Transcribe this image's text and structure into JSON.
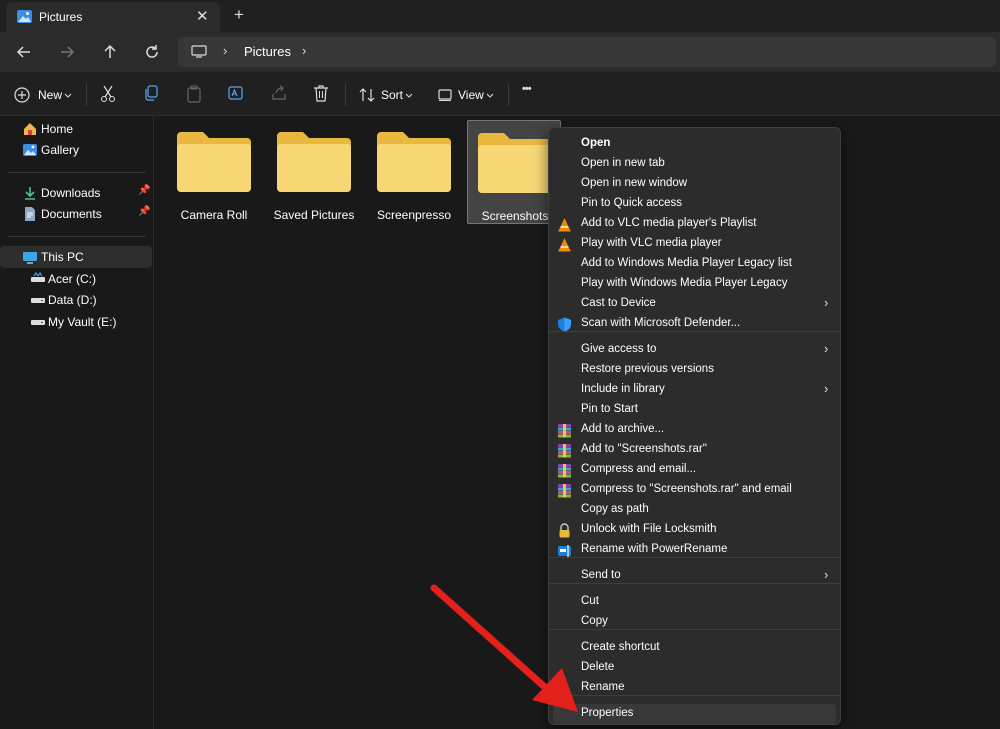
{
  "tab": {
    "title": "Pictures",
    "close": "✕",
    "new": "+"
  },
  "address": {
    "sep": "›",
    "crumb": "Pictures"
  },
  "commands": {
    "new": "New",
    "sort": "Sort",
    "view": "View",
    "more": "•••"
  },
  "sidebar": {
    "items": [
      {
        "label": "Home",
        "icon": "home-icon"
      },
      {
        "label": "Gallery",
        "icon": "gallery-icon"
      },
      {
        "label": "Downloads",
        "icon": "downloads-icon",
        "pinned": true
      },
      {
        "label": "Documents",
        "icon": "documents-icon",
        "pinned": true
      },
      {
        "label": "This PC",
        "icon": "this-pc-icon",
        "selected": true
      },
      {
        "label": "Acer (C:)",
        "icon": "drive-icon"
      },
      {
        "label": "Data (D:)",
        "icon": "drive-icon"
      },
      {
        "label": "My Vault (E:)",
        "icon": "drive-icon"
      }
    ]
  },
  "folders": [
    {
      "name": "Camera Roll"
    },
    {
      "name": "Saved Pictures"
    },
    {
      "name": "Screenpresso"
    },
    {
      "name": "Screenshots",
      "selected": true
    }
  ],
  "context_menu": {
    "items": [
      {
        "label": "Open",
        "bold": true
      },
      {
        "label": "Open in new tab"
      },
      {
        "label": "Open in new window"
      },
      {
        "label": "Pin to Quick access"
      },
      {
        "label": "Add to VLC media player's Playlist",
        "icon": "vlc-icon"
      },
      {
        "label": "Play with VLC media player",
        "icon": "vlc-icon"
      },
      {
        "label": "Add to Windows Media Player Legacy list"
      },
      {
        "label": "Play with Windows Media Player Legacy"
      },
      {
        "label": "Cast to Device",
        "submenu": true
      },
      {
        "label": "Scan with Microsoft Defender...",
        "icon": "defender-shield-icon"
      },
      {
        "label": "Give access to",
        "submenu": true
      },
      {
        "label": "Restore previous versions"
      },
      {
        "label": "Include in library",
        "submenu": true
      },
      {
        "label": "Pin to Start"
      },
      {
        "label": "Add to archive...",
        "icon": "winrar-icon"
      },
      {
        "label": "Add to \"Screenshots.rar\"",
        "icon": "winrar-icon"
      },
      {
        "label": "Compress and email...",
        "icon": "winrar-icon"
      },
      {
        "label": "Compress to \"Screenshots.rar\" and email",
        "icon": "winrar-icon"
      },
      {
        "label": "Copy as path"
      },
      {
        "label": "Unlock with File Locksmith",
        "icon": "lock-icon"
      },
      {
        "label": "Rename with PowerRename",
        "icon": "power-rename-icon"
      },
      {
        "label": "Send to",
        "submenu": true
      },
      {
        "label": "Cut"
      },
      {
        "label": "Copy"
      },
      {
        "label": "Create shortcut"
      },
      {
        "label": "Delete"
      },
      {
        "label": "Rename"
      },
      {
        "label": "Properties",
        "hovered": true
      }
    ],
    "chevron": "›"
  },
  "colors": {
    "folder": "#f8d775",
    "folder_tab": "#e8b93e",
    "arrow": "#e3201b",
    "accent": "#4cc2ff"
  }
}
